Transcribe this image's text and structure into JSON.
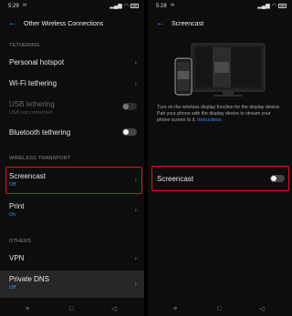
{
  "left": {
    "status": {
      "time": "5:29"
    },
    "header": {
      "back_glyph": "←",
      "title": "Other Wireless Connections"
    },
    "sections": {
      "tethering": "TETHERING",
      "wireless_transport": "WIRELESS TRANSPORT",
      "others": "OTHERS"
    },
    "items": {
      "personal_hotspot": {
        "label": "Personal hotspot"
      },
      "wifi_tethering": {
        "label": "Wi-Fi tethering"
      },
      "usb_tethering": {
        "label": "USB tethering",
        "sub": "USB not connected",
        "toggle": "off"
      },
      "bluetooth_tethering": {
        "label": "Bluetooth tethering",
        "toggle": "off"
      },
      "screencast": {
        "label": "Screencast",
        "sub": "Off"
      },
      "print": {
        "label": "Print",
        "sub": "On"
      },
      "vpn": {
        "label": "VPN"
      },
      "private_dns": {
        "label": "Private DNS",
        "sub": "Off"
      }
    }
  },
  "right": {
    "status": {
      "time": "5:28"
    },
    "header": {
      "back_glyph": "←",
      "title": "Screencast"
    },
    "description": {
      "text": "Turn on the wireless display function for the display device. Pair your phone with the display device to stream your phone screen to it.",
      "link": "Instructions"
    },
    "screencast_toggle": {
      "label": "Screencast",
      "state": "off"
    }
  },
  "nav": {
    "menu_glyph": "≡",
    "home_glyph": "□",
    "back_glyph": "◁"
  },
  "colors": {
    "accent": "#3d8bff",
    "highlight": "#e0141f",
    "background": "#0d0d0d"
  }
}
